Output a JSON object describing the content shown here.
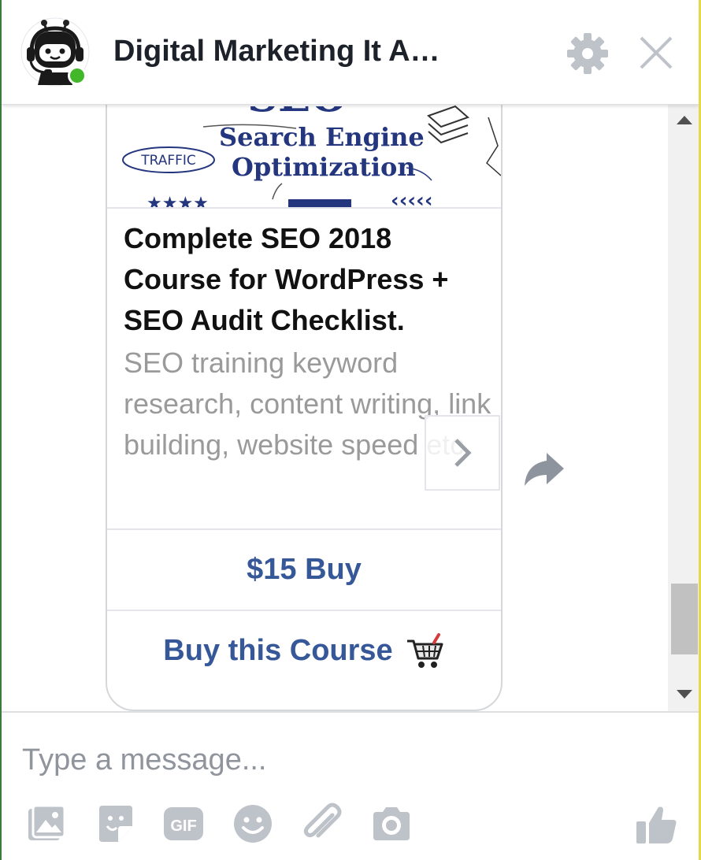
{
  "header": {
    "title": "Digital Marketing It A…",
    "avatar_icon": "robot-headset-icon",
    "status": "online",
    "settings_icon": "gear-icon",
    "close_icon": "close-icon"
  },
  "card": {
    "image": {
      "line1": "Search Engine",
      "line2": "Optimization",
      "badge": "TRAFFIC",
      "top_text": "SEO"
    },
    "title": "Complete SEO 2018 Course for WordPress + SEO Audit Checklist.",
    "subtitle": "SEO training keyword research, content writing, link building, website speed etc",
    "buttons": [
      {
        "label": "$15 Buy"
      },
      {
        "label": "Buy this Course",
        "icon": "shopping-cart-icon"
      }
    ],
    "next_icon": "chevron-right-icon"
  },
  "share_icon": "share-icon",
  "composer": {
    "placeholder": "Type a message...",
    "tools": [
      "image-icon",
      "sticker-icon",
      "gif-icon",
      "emoji-icon",
      "attachment-icon",
      "camera-icon",
      "thumbs-up-icon"
    ],
    "gif_label": "GIF"
  },
  "colors": {
    "accent": "#365899",
    "icon_gray": "#bec2c9",
    "online": "#42b72a"
  }
}
